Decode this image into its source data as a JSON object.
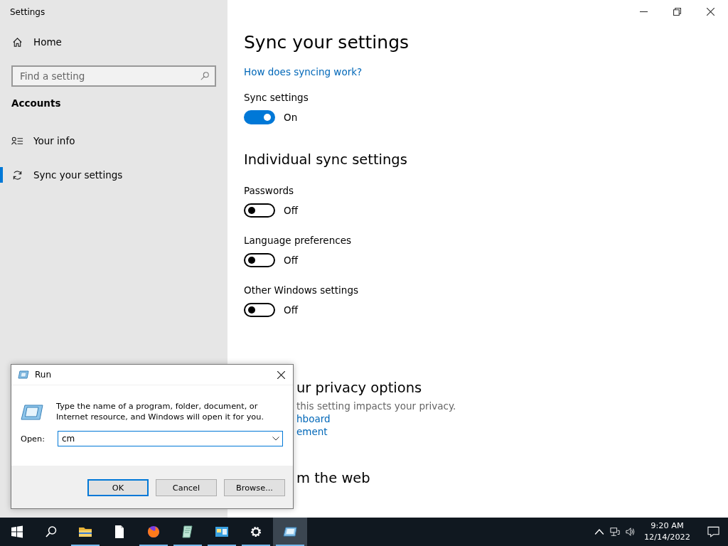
{
  "window": {
    "title": "Settings"
  },
  "sidebar": {
    "home": "Home",
    "search": {
      "placeholder": "Find a setting"
    },
    "section": "Accounts",
    "items": [
      {
        "label": "Your info",
        "kind": "person",
        "selected": false
      },
      {
        "label": "Sync your settings",
        "kind": "sync",
        "selected": true
      }
    ]
  },
  "page": {
    "title": "Sync your settings",
    "link": "How does syncing work?",
    "sync": {
      "label": "Sync settings",
      "on": true,
      "state": "On"
    },
    "section": "Individual sync settings",
    "toggles": [
      {
        "label": "Passwords",
        "on": false,
        "state": "Off"
      },
      {
        "label": "Language preferences",
        "on": false,
        "state": "Off"
      },
      {
        "label": "Other Windows settings",
        "on": false,
        "state": "Off"
      }
    ],
    "privacy": {
      "heading": "ur privacy options",
      "text": "this setting impacts your privacy.",
      "links": [
        "hboard",
        "ement"
      ]
    },
    "help_heading": "m the web"
  },
  "run_dialog": {
    "title": "Run",
    "description": "Type the name of a program, folder, document, or Internet resource, and Windows will open it for you.",
    "open_label": "Open:",
    "value": "cm",
    "buttons": [
      {
        "label": "OK",
        "default": true
      },
      {
        "label": "Cancel",
        "default": false
      },
      {
        "label": "Browse...",
        "default": false
      }
    ]
  },
  "taskbar": {
    "apps": [
      {
        "kind": "start",
        "running": false,
        "selected": false
      },
      {
        "kind": "search",
        "running": false,
        "selected": false
      },
      {
        "kind": "folder",
        "running": true,
        "selected": false
      },
      {
        "kind": "document",
        "running": false,
        "selected": false
      },
      {
        "kind": "browser",
        "running": true,
        "selected": false
      },
      {
        "kind": "notepad",
        "running": true,
        "selected": false
      },
      {
        "kind": "panel",
        "running": true,
        "selected": false
      },
      {
        "kind": "gear",
        "running": true,
        "selected": false
      },
      {
        "kind": "run",
        "running": true,
        "selected": true
      }
    ],
    "time": "9:20 AM",
    "date": "12/14/2022"
  }
}
